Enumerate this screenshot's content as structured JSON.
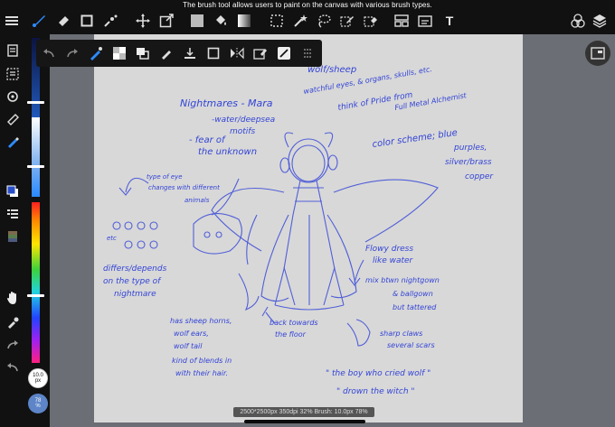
{
  "tooltip": "The brush tool allows users to paint on the canvas with various brush types.",
  "status_bar": "2500*2500px 350dpi 32% Brush: 10.0px 78%",
  "brush_size": {
    "value": "10.0",
    "unit": "px"
  },
  "opacity": {
    "value": "78",
    "unit": "%"
  },
  "colors": {
    "accent": "#2d8cff",
    "ink": "#3344d6",
    "canvas": "#d8d8d8",
    "chrome": "#111111"
  },
  "toolbar_icons": [
    "menu-icon",
    "brush-icon",
    "eraser-icon",
    "rectangle-icon",
    "blend-icon",
    "move-icon",
    "transform-icon",
    "fill-color-icon",
    "bucket-icon",
    "gradient-icon",
    "selection-icon",
    "magic-wand-icon",
    "lasso-icon",
    "select-pen-icon",
    "select-eraser-icon",
    "layer-frame-icon",
    "material-icon",
    "text-icon",
    "colors-icon",
    "layers-icon"
  ],
  "sketch_notes": {
    "title_line": "Nightmares - Mara",
    "wolf_sheep": "wolf/sheep",
    "water_deep": "-water/deepsea",
    "fear": "- fear of",
    "the_unknown": "the unknown",
    "motifs": "motifs",
    "watchful": "watchful eyes, & organs, skulls, etc.",
    "think_pride": "think of Pride from",
    "fullmetal": "Full Metal Alchemist",
    "color_scheme": "color scheme; blue",
    "purples": "purples,",
    "silver": "silver/brass",
    "copper": "copper",
    "typeofeye": "type of eye",
    "changes": "changes with different",
    "animals": "animals",
    "etc": "etc",
    "differs": "differs/depends",
    "onthe": "on the type of",
    "nightmare": "nightmare",
    "flowy": "Flowy dress",
    "likewater": "like water",
    "mix": "mix btwn nightgown",
    "ballgown": "& ballgown",
    "tattered": "but tattered",
    "back_towards": "back towards",
    "the_floor": "the floor",
    "sheep_horns": "has sheep horns,",
    "wolf_ears": "wolf ears,",
    "wolf_tail": "wolf tail",
    "kind_of": "kind of blends in",
    "with_hair": "with their hair.",
    "sharp_claws": "sharp claws",
    "several_scars": "several scars",
    "quote1": "\" the boy who cried wolf \"",
    "quote2": "\" drown the witch \""
  }
}
